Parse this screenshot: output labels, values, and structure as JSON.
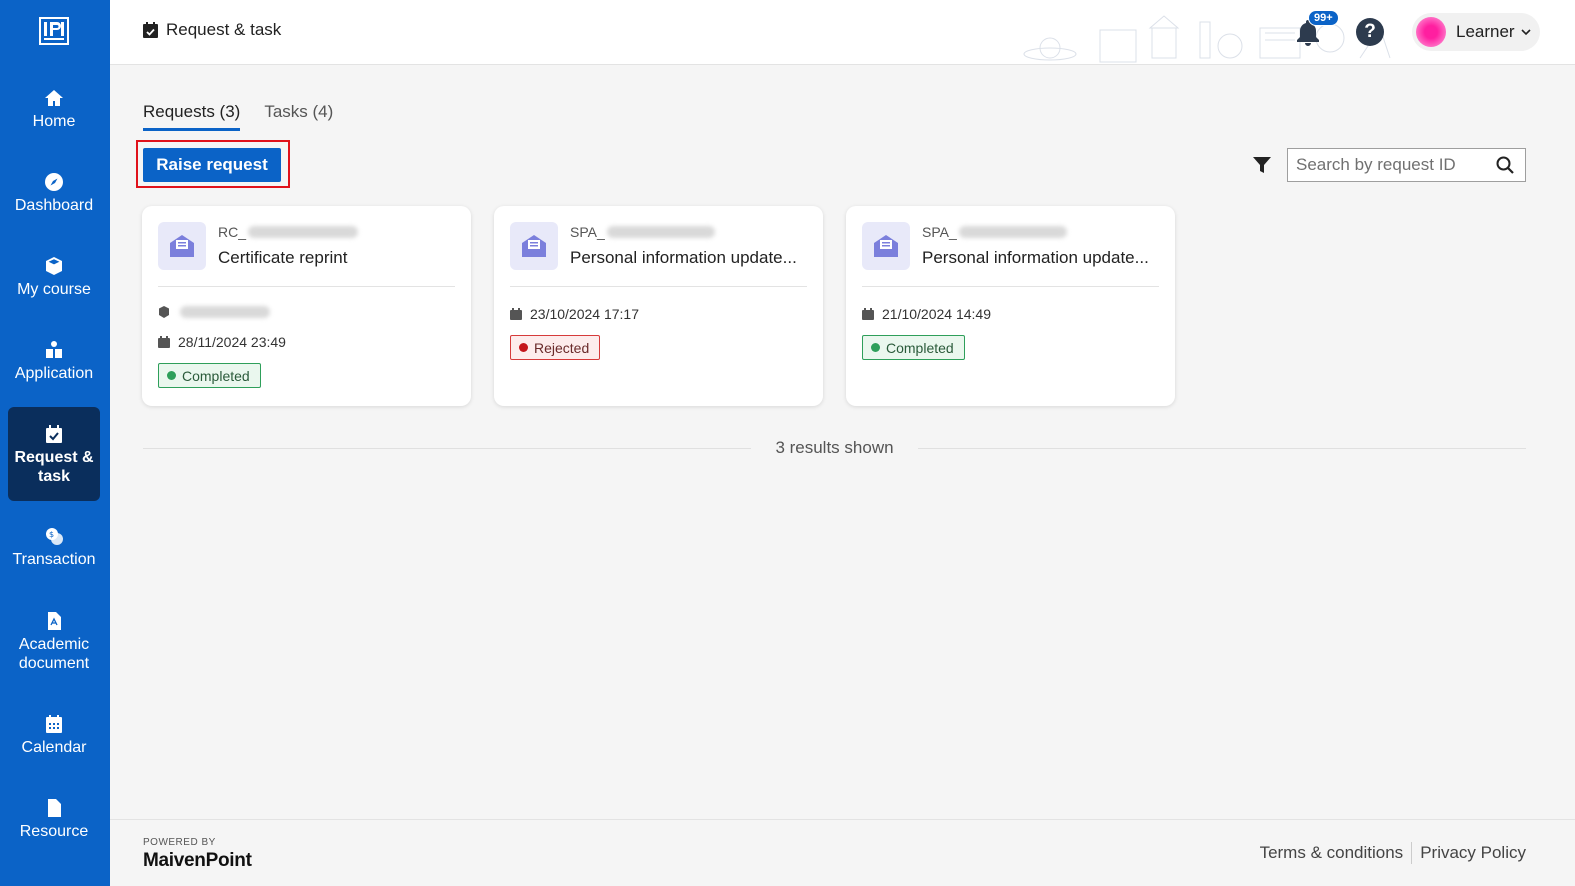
{
  "sidebar": {
    "logo": "IPI",
    "items": [
      {
        "label": "Home",
        "icon": "home-icon"
      },
      {
        "label": "Dashboard",
        "icon": "compass-icon"
      },
      {
        "label": "My course",
        "icon": "cube-icon"
      },
      {
        "label": "Application",
        "icon": "application-icon"
      },
      {
        "label": "Request & task",
        "icon": "calendar-check-icon",
        "active": true
      },
      {
        "label": "Transaction",
        "icon": "transaction-icon"
      },
      {
        "label": "Academic document",
        "icon": "pdf-file-icon"
      },
      {
        "label": "Calendar",
        "icon": "calendar-icon"
      },
      {
        "label": "Resource",
        "icon": "file-icon"
      }
    ]
  },
  "header": {
    "title": "Request & task",
    "notification_count": "99+",
    "help_label": "?",
    "user_name": "Learner"
  },
  "tabs": [
    {
      "label": "Requests (3)",
      "active": true
    },
    {
      "label": "Tasks (4)",
      "active": false
    }
  ],
  "toolbar": {
    "raise_request_label": "Raise request",
    "search_placeholder": "Search by request ID"
  },
  "cards": [
    {
      "id_prefix": "RC_",
      "title": "Certificate reprint",
      "has_course": true,
      "date": "28/11/2024 23:49",
      "status": "Completed",
      "status_type": "completed"
    },
    {
      "id_prefix": "SPA_",
      "title": "Personal information update...",
      "has_course": false,
      "date": "23/10/2024 17:17",
      "status": "Rejected",
      "status_type": "rejected"
    },
    {
      "id_prefix": "SPA_",
      "title": "Personal information update...",
      "has_course": false,
      "date": "21/10/2024 14:49",
      "status": "Completed",
      "status_type": "completed"
    }
  ],
  "results_text": "3 results shown",
  "footer": {
    "powered_by": "POWERED BY",
    "brand": "MaivenPoint",
    "terms": "Terms & conditions",
    "privacy": "Privacy Policy"
  },
  "colors": {
    "sidebar_bg": "#0b63c7",
    "sidebar_active": "#0a2e5c",
    "primary": "#0b63c7",
    "completed": "#2e9f5a",
    "rejected": "#c4161c",
    "highlight_border": "#e0121b"
  }
}
